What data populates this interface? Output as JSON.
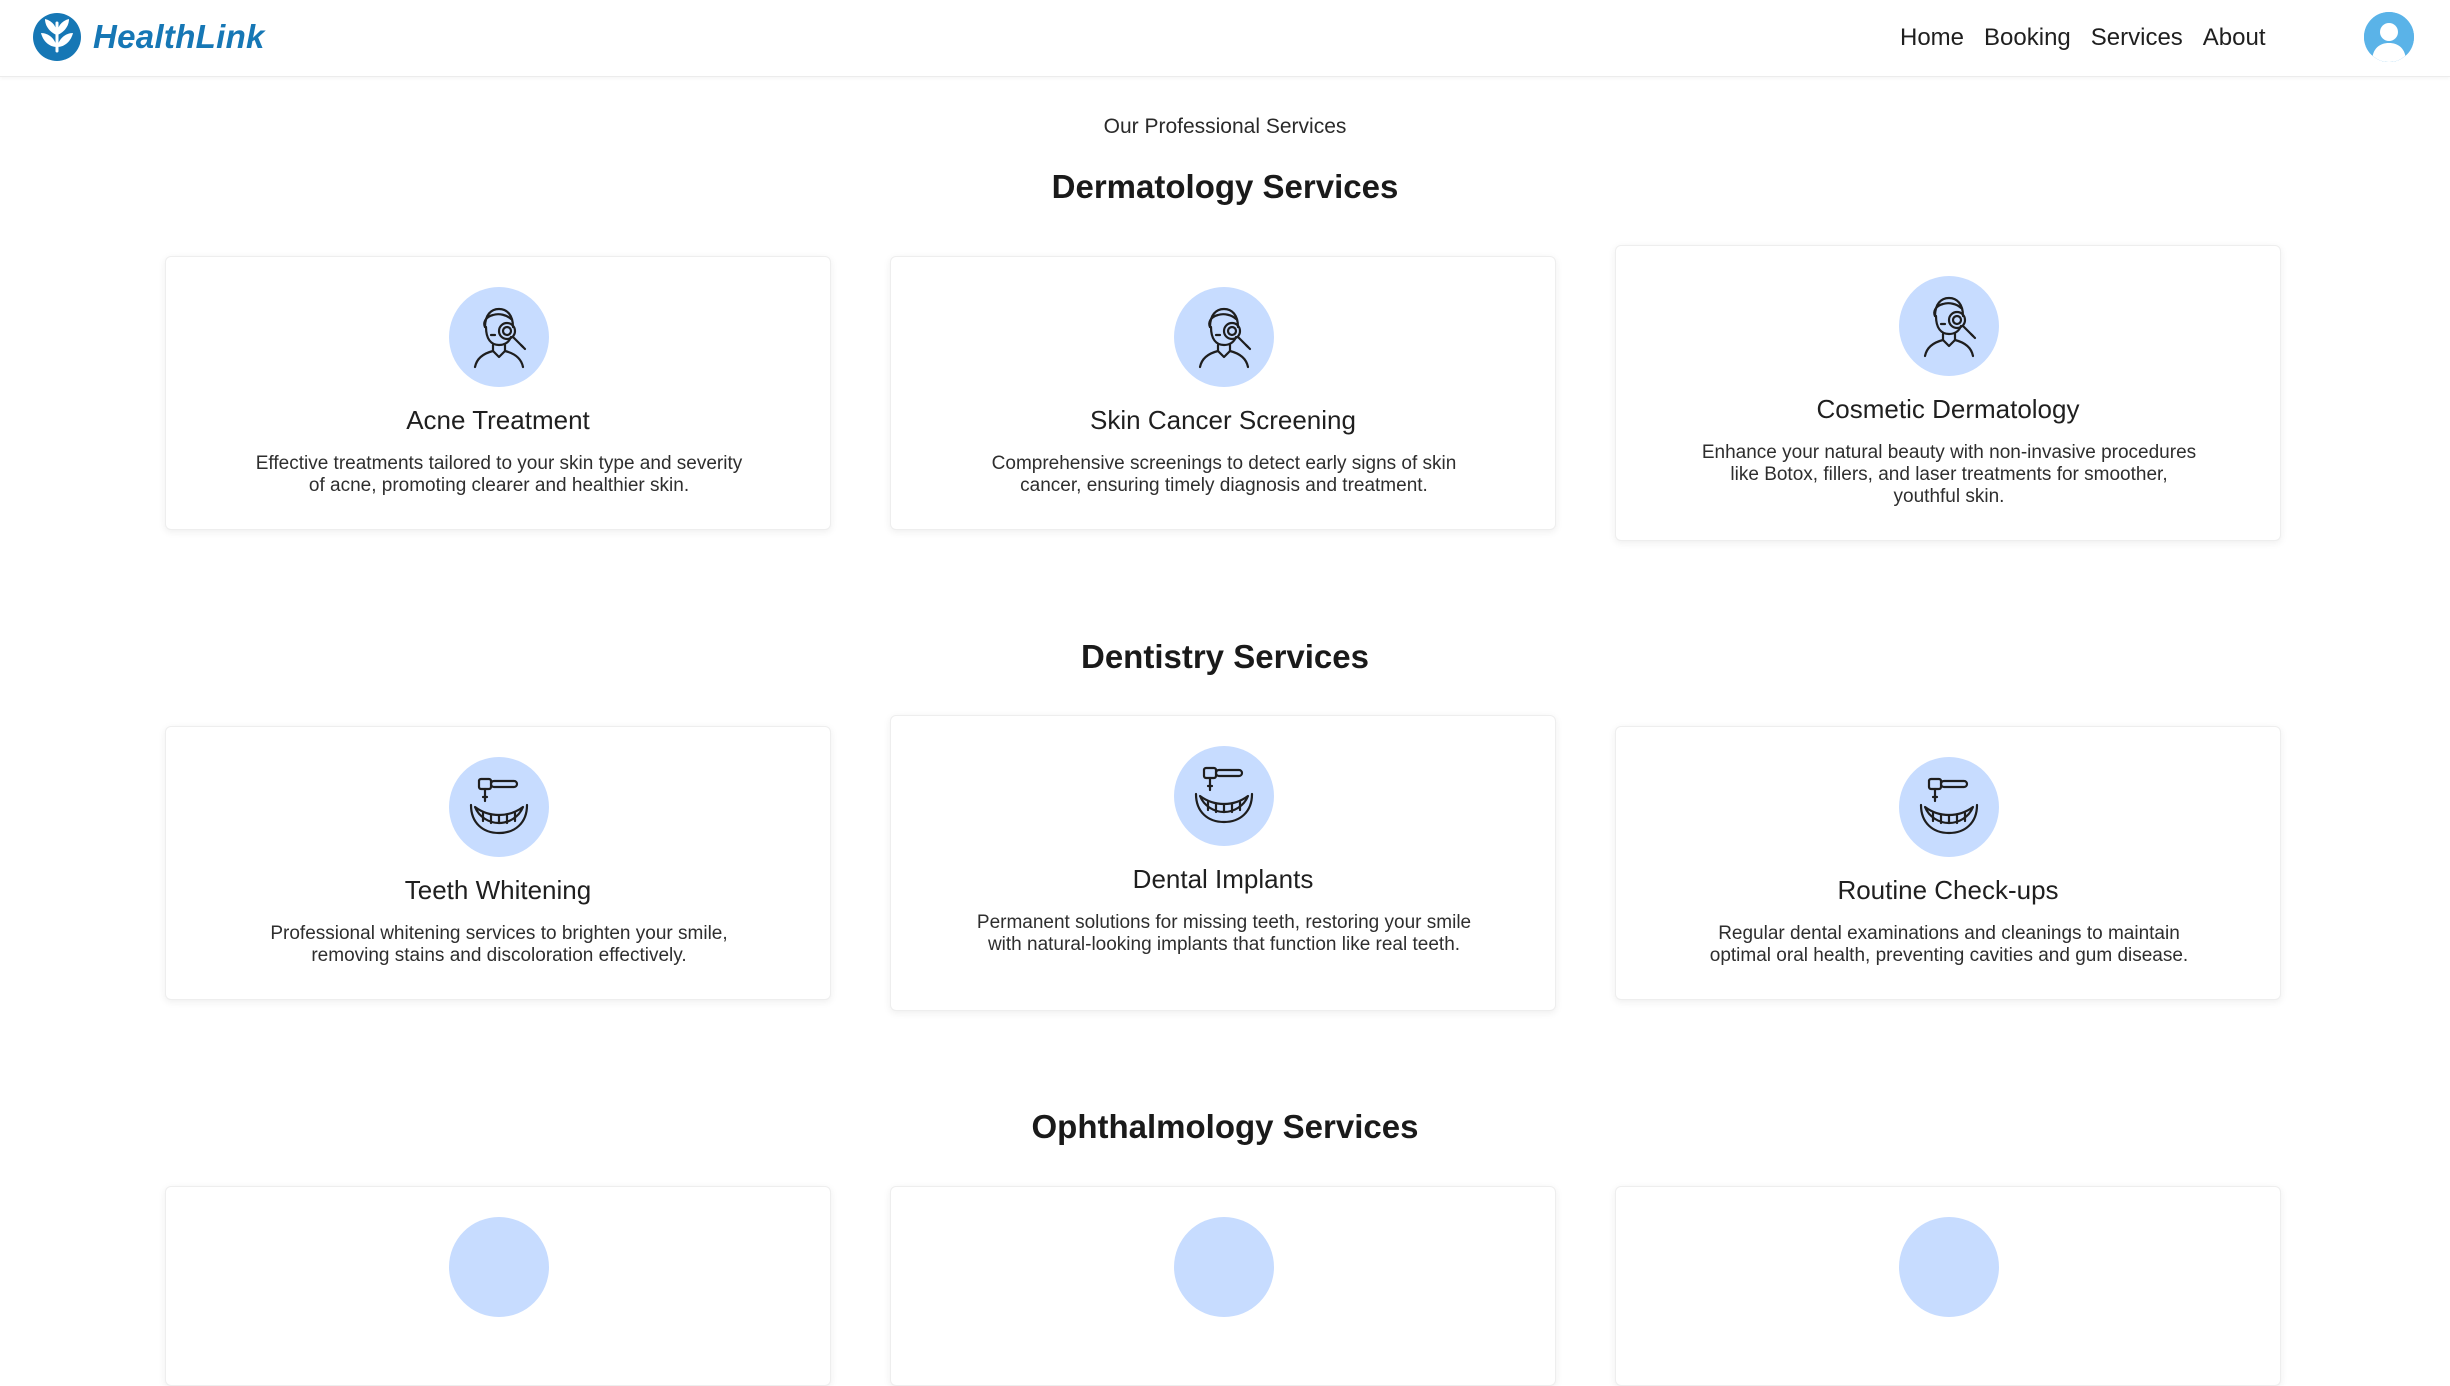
{
  "nav": {
    "brand": "HealthLink",
    "links": [
      "Home",
      "Booking",
      "Services",
      "About"
    ],
    "brand_color": "#1677b5"
  },
  "page": {
    "kicker": "Our Professional Services"
  },
  "sections": [
    {
      "title": "Dermatology Services",
      "icon": "skin-examination-icon",
      "cards": [
        {
          "title": "Acne Treatment",
          "desc": "Effective treatments tailored to your skin type and severity of acne, promoting clearer and healthier skin."
        },
        {
          "title": "Skin Cancer Screening",
          "desc": "Comprehensive screenings to detect early signs of skin cancer, ensuring timely diagnosis and treatment."
        },
        {
          "title": "Cosmetic Dermatology",
          "desc": "Enhance your natural beauty with non-invasive procedures like Botox, fillers, and laser treatments for smoother, youthful skin."
        }
      ]
    },
    {
      "title": "Dentistry Services",
      "icon": "dental-drill-icon",
      "cards": [
        {
          "title": "Teeth Whitening",
          "desc": "Professional whitening services to brighten your smile, removing stains and discoloration effectively."
        },
        {
          "title": "Dental Implants",
          "desc": "Permanent solutions for missing teeth, restoring your smile with natural-looking implants that function like real teeth."
        },
        {
          "title": "Routine Check-ups",
          "desc": "Regular dental examinations and cleanings to maintain optimal oral health, preventing cavities and gum disease."
        }
      ]
    },
    {
      "title": "Ophthalmology Services",
      "cards": []
    }
  ],
  "colors": {
    "icon_circle": "#c7dcff",
    "avatar": "#5ab3e8"
  }
}
